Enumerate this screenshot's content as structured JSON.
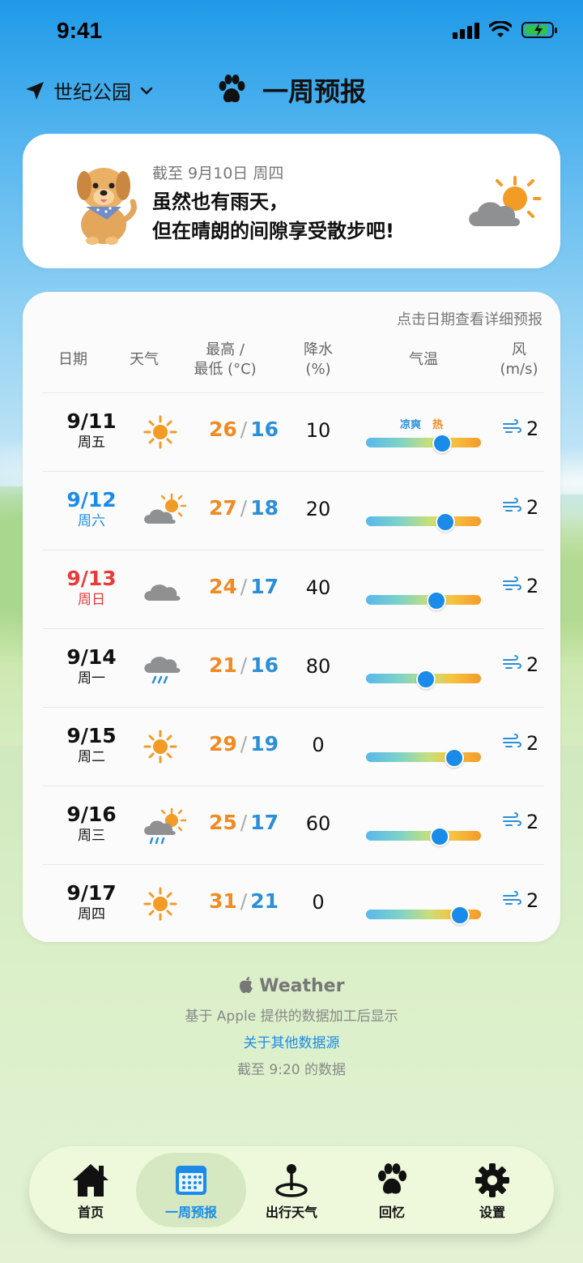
{
  "status": {
    "time": "9:41"
  },
  "header": {
    "location": "世纪公园",
    "title": "一周预报"
  },
  "summary": {
    "as_of": "截至 9月10日 周四",
    "message": "虽然也有雨天，\n但在晴朗的间隙享受散步吧!",
    "icon": "partly-cloudy-icon"
  },
  "forecast": {
    "hint": "点击日期查看详细预报",
    "columns": {
      "date": "日期",
      "weather": "天气",
      "temp_line1": "最高 /",
      "temp_line2": "最低 (°C)",
      "rain_line1": "降水",
      "rain_line2": "(%)",
      "gauge": "气温",
      "wind_line1": "风",
      "wind_line2": "(m/s)"
    },
    "gauge_legend": {
      "cool": "凉爽",
      "hot": "热"
    },
    "days": [
      {
        "date": "9/11",
        "weekday": "周五",
        "weather": "sunny-icon",
        "high": "26",
        "low": "16",
        "rain": "10",
        "temp_level": 0.66,
        "wind": "2",
        "color": "#111111"
      },
      {
        "date": "9/12",
        "weekday": "周六",
        "weather": "partly-cloudy-icon",
        "high": "27",
        "low": "18",
        "rain": "20",
        "temp_level": 0.69,
        "wind": "2",
        "color": "#1a8be8"
      },
      {
        "date": "9/13",
        "weekday": "周日",
        "weather": "cloudy-icon",
        "high": "24",
        "low": "17",
        "rain": "40",
        "temp_level": 0.61,
        "wind": "2",
        "color": "#e83a3a"
      },
      {
        "date": "9/14",
        "weekday": "周一",
        "weather": "rain-icon",
        "high": "21",
        "low": "16",
        "rain": "80",
        "temp_level": 0.52,
        "wind": "2",
        "color": "#111111"
      },
      {
        "date": "9/15",
        "weekday": "周二",
        "weather": "sunny-icon",
        "high": "29",
        "low": "19",
        "rain": "0",
        "temp_level": 0.77,
        "wind": "2",
        "color": "#111111"
      },
      {
        "date": "9/16",
        "weekday": "周三",
        "weather": "sun-cloud-rain-icon",
        "high": "25",
        "low": "17",
        "rain": "60",
        "temp_level": 0.64,
        "wind": "2",
        "color": "#111111"
      },
      {
        "date": "9/17",
        "weekday": "周四",
        "weather": "sunny-icon",
        "high": "31",
        "low": "21",
        "rain": "0",
        "temp_level": 0.82,
        "wind": "2",
        "color": "#111111"
      }
    ]
  },
  "attribution": {
    "brand": "Weather",
    "line1": "基于 Apple 提供的数据加工后显示",
    "link": "关于其他数据源",
    "line2": "截至 9:20 的数据"
  },
  "tabs": [
    {
      "label": "首页",
      "icon": "house-icon"
    },
    {
      "label": "一周预报",
      "icon": "calendar-icon",
      "active": true
    },
    {
      "label": "出行天气",
      "icon": "map-pin-icon"
    },
    {
      "label": "回忆",
      "icon": "paw-icon"
    },
    {
      "label": "设置",
      "icon": "gear-icon"
    }
  ]
}
